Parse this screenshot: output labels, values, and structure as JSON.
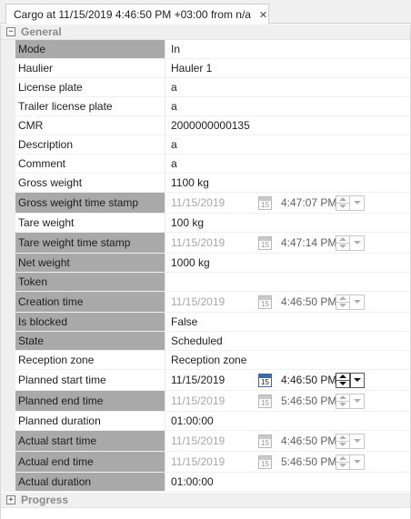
{
  "tab": {
    "title": "Cargo at 11/15/2019 4:46:50 PM +03:00 from n/a",
    "close_glyph": "✕"
  },
  "categories": {
    "general": "General",
    "progress": "Progress"
  },
  "expand_glyphs": {
    "collapse": "−",
    "expand": "+"
  },
  "calendar_day": "15",
  "properties": {
    "mode": {
      "label": "Mode",
      "value": "In"
    },
    "haulier": {
      "label": "Haulier",
      "value": "Hauler 1"
    },
    "license_plate": {
      "label": "License plate",
      "value": "a"
    },
    "trailer_plate": {
      "label": "Trailer license plate",
      "value": "a"
    },
    "cmr": {
      "label": "CMR",
      "value": "2000000000135"
    },
    "description": {
      "label": "Description",
      "value": "a"
    },
    "comment": {
      "label": "Comment",
      "value": "a"
    },
    "gross_weight": {
      "label": "Gross weight",
      "value": "1100 kg"
    },
    "gross_weight_ts": {
      "label": "Gross weight time stamp",
      "date": "11/15/2019",
      "time": "4:47:07 PM"
    },
    "tare_weight": {
      "label": "Tare weight",
      "value": "100 kg"
    },
    "tare_weight_ts": {
      "label": "Tare weight time stamp",
      "date": "11/15/2019",
      "time": "4:47:14 PM"
    },
    "net_weight": {
      "label": "Net weight",
      "value": "1000 kg"
    },
    "token": {
      "label": "Token",
      "value": ""
    },
    "creation_time": {
      "label": "Creation time",
      "date": "11/15/2019",
      "time": "4:46:50 PM"
    },
    "is_blocked": {
      "label": "Is blocked",
      "value": "False"
    },
    "state": {
      "label": "State",
      "value": "Scheduled"
    },
    "reception_zone": {
      "label": "Reception zone",
      "value": "Reception zone"
    },
    "planned_start": {
      "label": "Planned start time",
      "date": "11/15/2019",
      "time": "4:46:50 PM"
    },
    "planned_end": {
      "label": "Planned end time",
      "date": "11/15/2019",
      "time": "5:46:50 PM"
    },
    "planned_duration": {
      "label": "Planned duration",
      "value": "01:00:00"
    },
    "actual_start": {
      "label": "Actual start time",
      "date": "11/15/2019",
      "time": "4:46:50 PM"
    },
    "actual_end": {
      "label": "Actual end time",
      "date": "11/15/2019",
      "time": "5:46:50 PM"
    },
    "actual_duration": {
      "label": "Actual duration",
      "value": "01:00:00"
    }
  },
  "colors": {
    "readonly_label_bg": "#a9a9a9",
    "category_bg": "#f0f0f0",
    "disabled_text": "#a8a8a8",
    "calendar_active": "#3c6aa0"
  }
}
